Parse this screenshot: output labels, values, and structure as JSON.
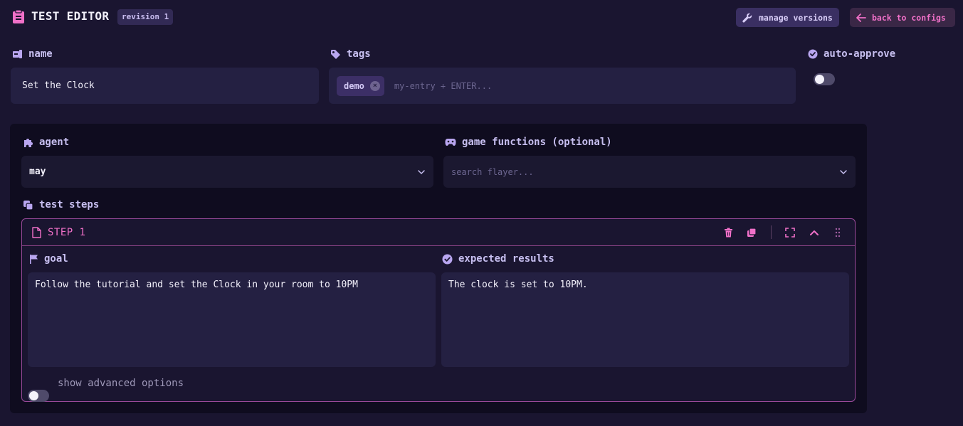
{
  "header": {
    "title": "TEST EDITOR",
    "revision": "revision 1",
    "manage_versions": "manage versions",
    "back_to_configs": "back to configs"
  },
  "name": {
    "label": "name",
    "value": "Set the Clock"
  },
  "tags": {
    "label": "tags",
    "items": [
      "demo"
    ],
    "placeholder": "my-entry + ENTER..."
  },
  "auto_approve": {
    "label": "auto-approve",
    "enabled": false
  },
  "agent": {
    "label": "agent",
    "value": "may"
  },
  "game_functions": {
    "label": "game functions (optional)",
    "placeholder": "search flayer..."
  },
  "test_steps": {
    "label": "test steps",
    "steps": [
      {
        "title": "STEP 1",
        "goal_label": "goal",
        "goal": "Follow the tutorial and set the Clock in your room to 10PM",
        "expected_label": "expected results",
        "expected": "The clock is set to 10PM."
      }
    ],
    "advanced_label": "show advanced options",
    "advanced_enabled": false
  },
  "colors": {
    "background": "#1a1530",
    "accent_pink": "#f070c8",
    "accent_purple": "#b9a6f0",
    "panel": "#0f0c1f",
    "field": "#242042"
  }
}
